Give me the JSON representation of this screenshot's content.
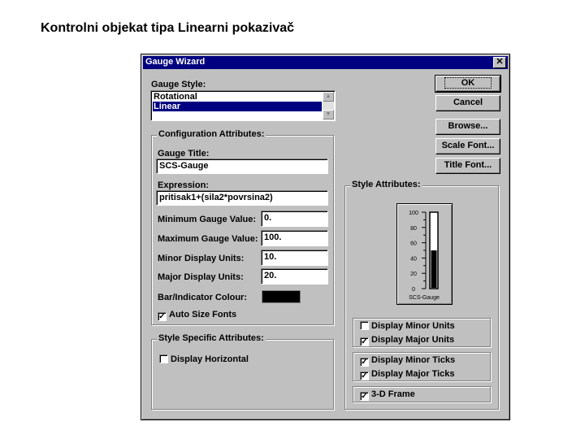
{
  "slide": {
    "title": "Kontrolni objekat tipa Linearni pokazivač"
  },
  "dialog": {
    "title": "Gauge Wizard",
    "close_glyph": "✕",
    "gauge_style": {
      "label": "Gauge Style:",
      "options": [
        "Rotational",
        "Linear"
      ],
      "selected": "Linear"
    },
    "buttons": {
      "ok": "OK",
      "cancel": "Cancel",
      "browse": "Browse...",
      "scale_font": "Scale Font...",
      "title_font": "Title Font..."
    },
    "config": {
      "group_title": "Configuration Attributes:",
      "gauge_title_label": "Gauge Title:",
      "gauge_title_value": "SCS-Gauge",
      "expression_label": "Expression:",
      "expression_value": "pritisak1+(sila2*povrsina2)",
      "min_label": "Minimum Gauge Value:",
      "min_value": "0.",
      "max_label": "Maximum Gauge Value:",
      "max_value": "100.",
      "minor_units_label": "Minor Display Units:",
      "minor_units_value": "10.",
      "major_units_label": "Major Display Units:",
      "major_units_value": "20.",
      "colour_label": "Bar/Indicator Colour:",
      "colour_value": "#000000",
      "auto_size_label": "Auto Size Fonts",
      "auto_size_checked": true
    },
    "style_specific": {
      "group_title": "Style Specific Attributes:",
      "display_horizontal_label": "Display Horizontal",
      "display_horizontal_checked": false
    },
    "style_attrs": {
      "group_title": "Style Attributes:",
      "preview": {
        "scale_labels": [
          "100",
          "80",
          "60",
          "40",
          "20",
          "0"
        ],
        "min": 0,
        "max": 100,
        "value": 50,
        "caption": "SCS-Gauge"
      },
      "display_minor_units": {
        "label": "Display Minor Units",
        "checked": false
      },
      "display_major_units": {
        "label": "Display Major Units",
        "checked": true
      },
      "display_minor_ticks": {
        "label": "Display Minor Ticks",
        "checked": true
      },
      "display_major_ticks": {
        "label": "Display Major Ticks",
        "checked": true
      },
      "frame_3d": {
        "label": "3-D Frame",
        "checked": true
      }
    }
  }
}
